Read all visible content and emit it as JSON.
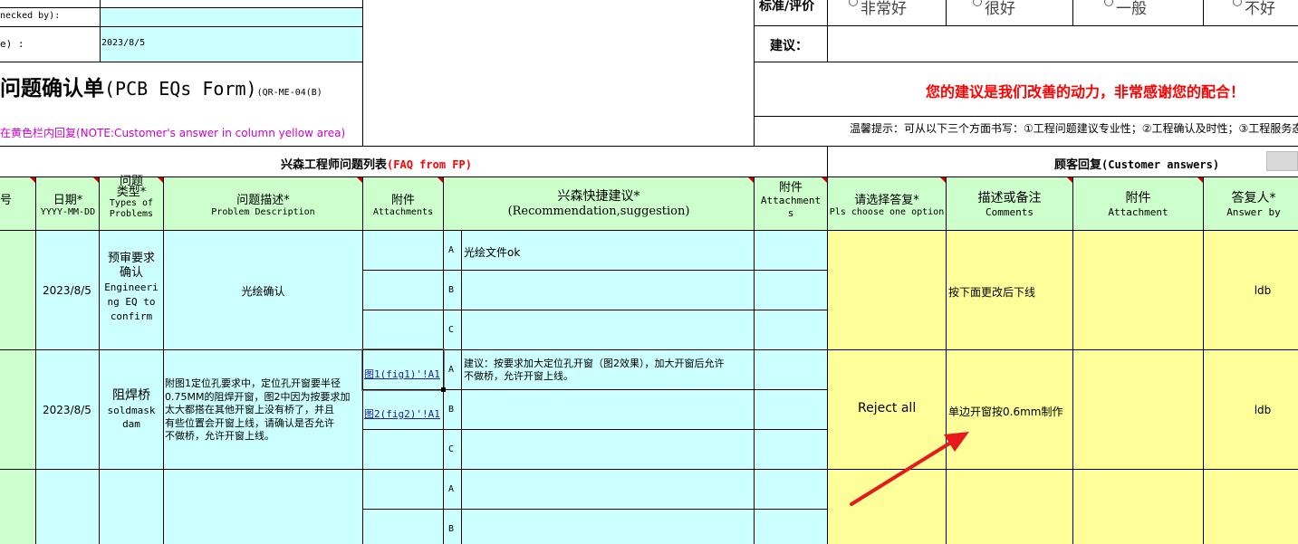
{
  "top_left": {
    "checked_by_label": "necked by):",
    "date_label": "e) :",
    "date_value": "2023/8/5",
    "form_title_cn": "问题确认单",
    "form_title_en": "(PCB EQs Form)",
    "form_code": "(QR-ME-04(B)",
    "note": "在黄色栏内回复(NOTE:Customer's answer in column yellow area)"
  },
  "top_right": {
    "rating_label": "标准/评价",
    "rating_options": [
      "非常好",
      "很好",
      "一般",
      "不好"
    ],
    "suggest_label": "建议：",
    "thanks": "您的建议是我们改善的动力，非常感谢您的配合！",
    "tips": "温馨提示：可从以下三个方面书写：①工程问题建议专业性；②工程确认及时性；③工程服务态"
  },
  "section_headers": {
    "faq_cn": "兴森工程师问题列表",
    "faq_en": "(FAQ from FP)",
    "customer_cn": "顾客回复",
    "customer_en": "(Customer answers)"
  },
  "columns": {
    "no": "号",
    "date_cn": "日期*",
    "date_en": "YYYY-MM-DD",
    "type_cn1": "问题",
    "type_cn2": "类型*",
    "type_en1": "Types of",
    "type_en2": "Problems",
    "desc_cn": "问题描述*",
    "desc_en": "Problem Description",
    "attach_cn": "附件",
    "attach_en": "Attachments",
    "rec_cn": "兴森快捷建议*",
    "rec_en": "(Recommendation,suggestion)",
    "attach2_cn": "附件",
    "attach2_en1": "Attachment",
    "attach2_en2": "s",
    "choose_cn": "请选择答复*",
    "choose_en": "Pls choose one option",
    "comments_cn": "描述或备注",
    "comments_en": "Comments",
    "attach3_cn": "附件",
    "attach3_en": "Attachment",
    "answer_cn": "答复人*",
    "answer_en": "Answer by"
  },
  "rows": [
    {
      "date": "2023/8/5",
      "type_lines": [
        "预审要求",
        "确认",
        "Engineeri",
        "ng EQ to",
        "confirm"
      ],
      "desc": "光绘确认",
      "options": [
        "A",
        "B",
        "C"
      ],
      "rec_a": "光绘文件ok",
      "choice": "",
      "comment": "按下面更改后下线",
      "answer_by": "ldb"
    },
    {
      "date": "2023/8/5",
      "type_lines": [
        "阻焊桥",
        "soldmask",
        "dam"
      ],
      "desc_lines": [
        "附图1定位孔要求中，定位孔开窗要半径",
        "0.75MM的阻焊开窗，图2中因为按要求加",
        "太大都搭在其他开窗上没有桥了，并且",
        "有些位置会开窗上线，请确认是否允许",
        "不做桥，允许开窗上线。"
      ],
      "link_a": "图1(fig1)'!A1",
      "link_b": "图2(fig2)'!A1",
      "options": [
        "A",
        "B",
        "C"
      ],
      "rec_a_lines": [
        "建议：按要求加大定位孔开窗（图2效果），加大开窗后允许",
        "不做桥，允许开窗上线。"
      ],
      "choice": "Reject all",
      "comment": "单边开窗按0.6mm制作",
      "answer_by": "ldb"
    },
    {
      "options": [
        "A",
        "B"
      ]
    }
  ],
  "colors": {
    "cyan": "#ccffff",
    "green": "#ccffcc",
    "yellow": "#ffff99",
    "title_red": "#ff0000",
    "note_magenta": "#cc00cc",
    "arrow_red": "#e8191c"
  }
}
